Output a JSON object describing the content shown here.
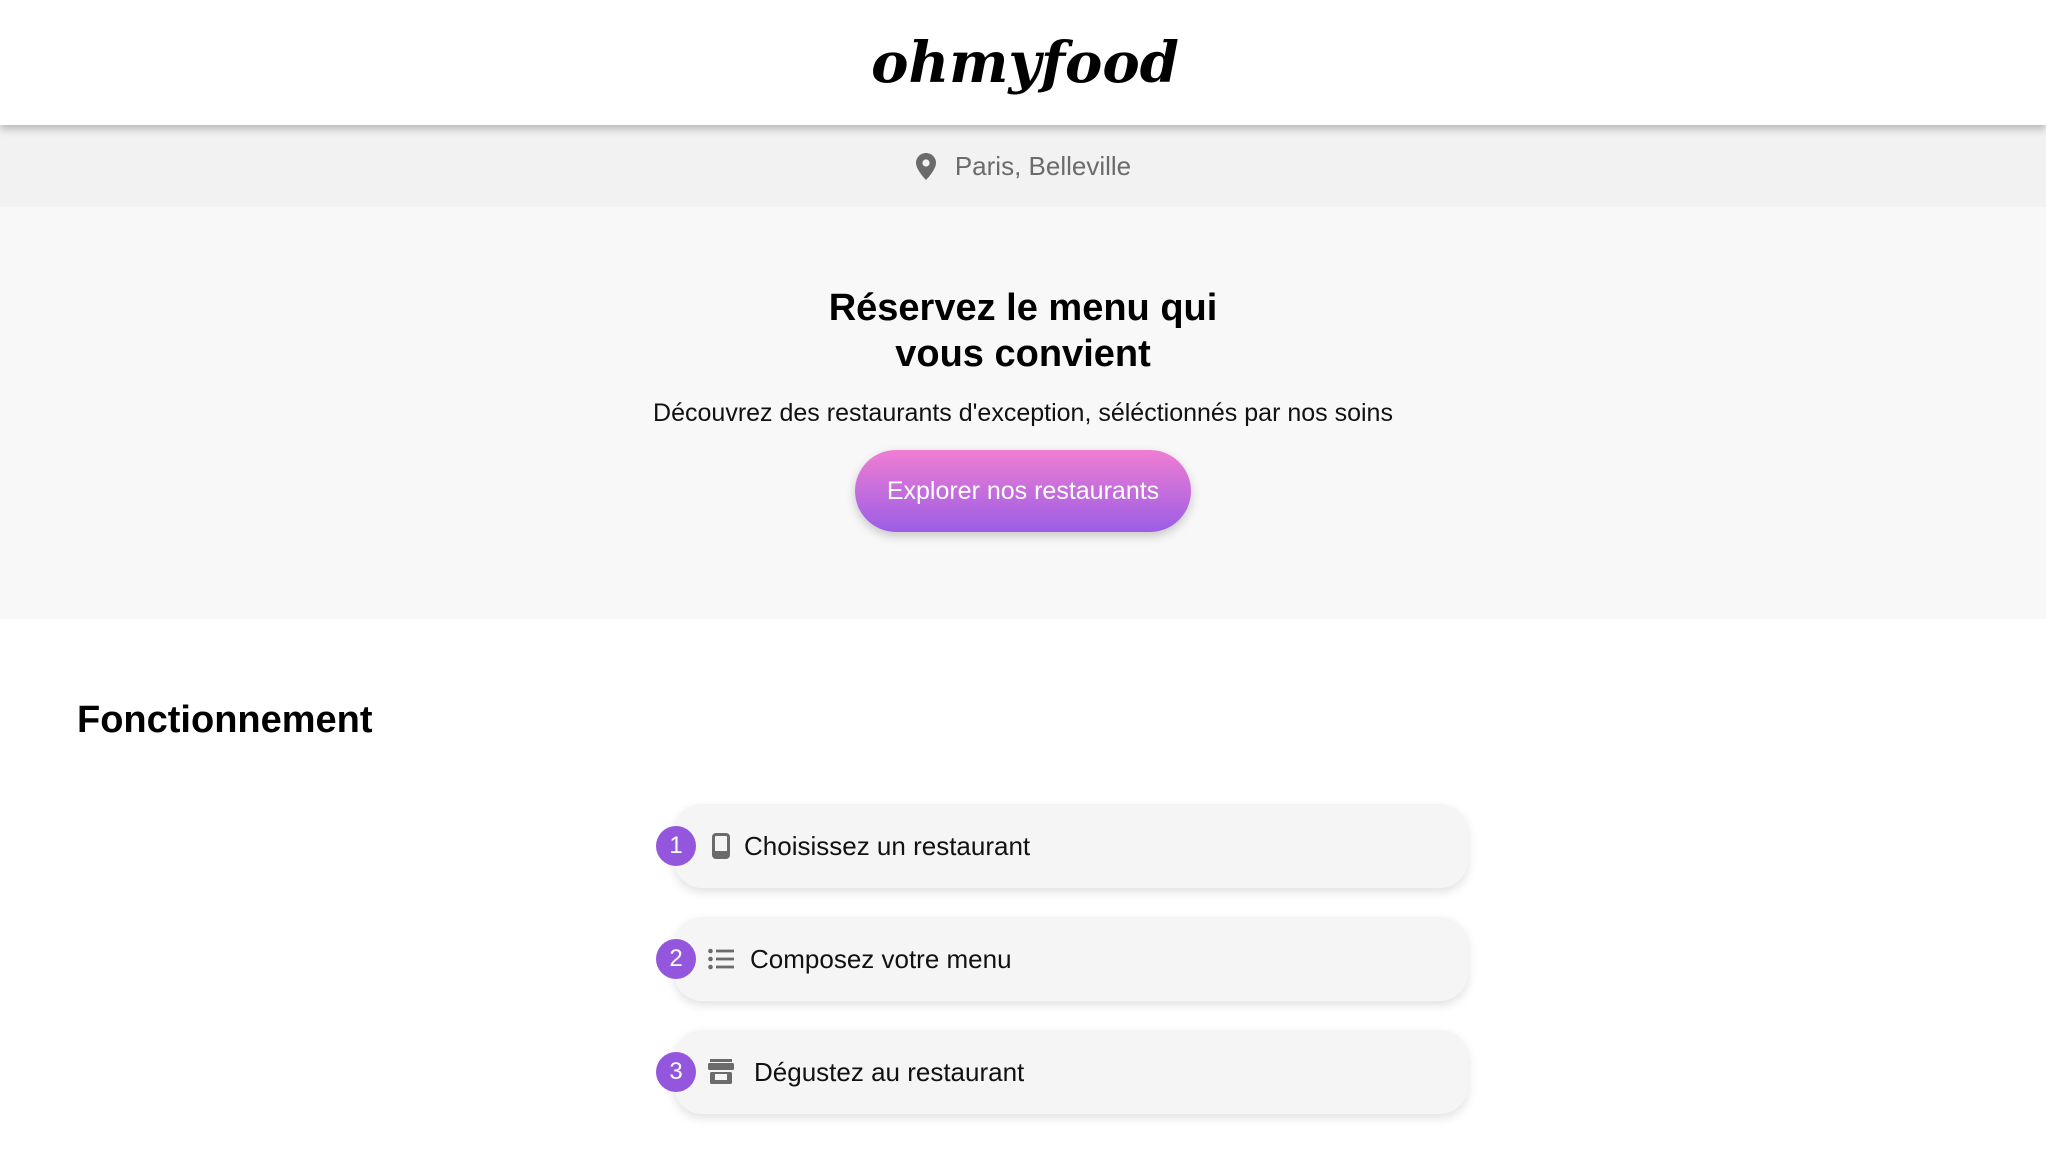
{
  "header": {
    "logo": "ohmyfood"
  },
  "location": {
    "icon": "location-pin-icon",
    "text": "Paris, Belleville"
  },
  "hero": {
    "title_line1": "Réservez le menu qui",
    "title_line2": "vous convient",
    "subtitle": "Découvrez des restaurants d'exception, séléctionnés par nos soins",
    "cta_label": "Explorer nos restaurants",
    "cta_gradient_top": "#f07ed2",
    "cta_gradient_bottom": "#9b5de6"
  },
  "how_it_works": {
    "title": "Fonctionnement",
    "accent_color": "#9356dc",
    "steps": [
      {
        "number": "1",
        "icon": "mobile-phone-icon",
        "label": "Choisissez un restaurant"
      },
      {
        "number": "2",
        "icon": "list-icon",
        "label": "Composez votre menu"
      },
      {
        "number": "3",
        "icon": "store-icon",
        "label": "Dégustez au restaurant"
      }
    ]
  }
}
